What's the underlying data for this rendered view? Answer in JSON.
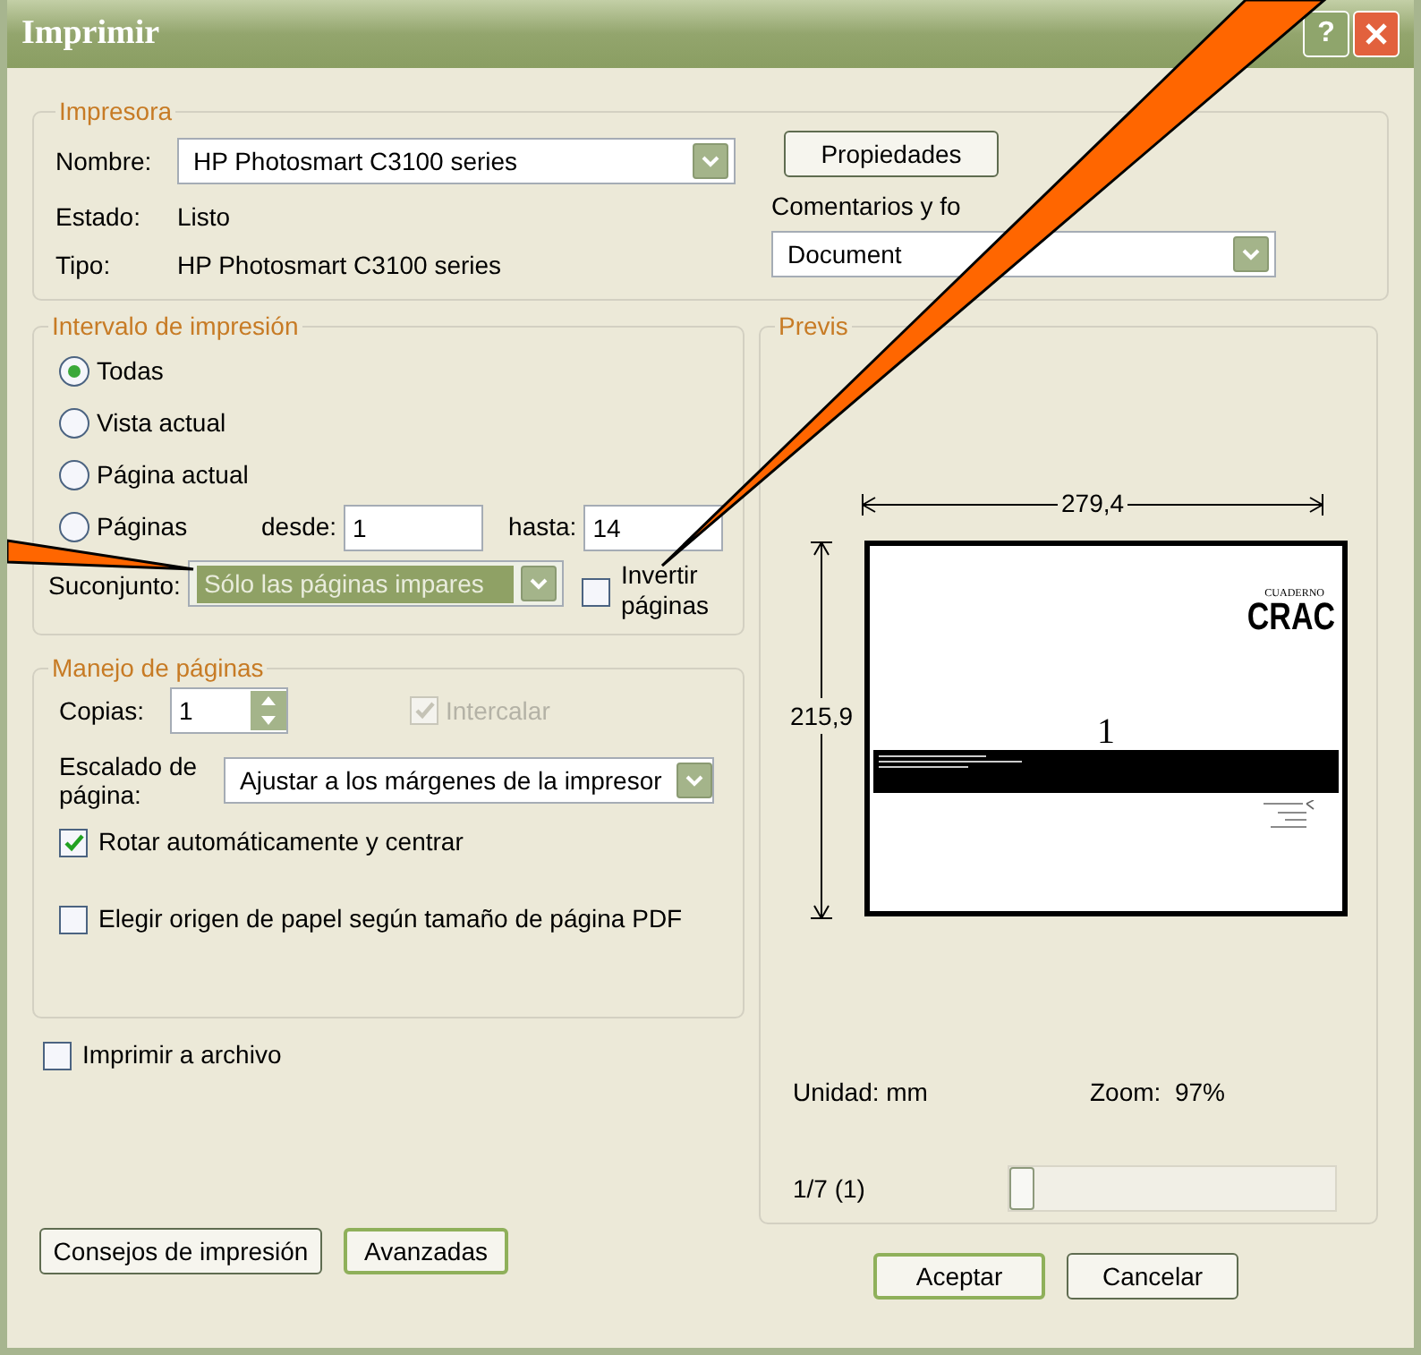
{
  "window": {
    "title": "Imprimir",
    "help_label": "?"
  },
  "printer": {
    "group_title": "Impresora",
    "name_label": "Nombre:",
    "name_value": "HP Photosmart C3100 series",
    "status_label": "Estado:",
    "status_value": "Listo",
    "type_label": "Tipo:",
    "type_value": "HP Photosmart C3100 series",
    "properties_button": "Propiedades",
    "comments_label": "Comentarios y fo",
    "comments_value": "Document"
  },
  "print_range": {
    "group_title": "Intervalo de impresión",
    "options": [
      {
        "label": "Todas",
        "selected": true
      },
      {
        "label": "Vista actual",
        "selected": false
      },
      {
        "label": "Página actual",
        "selected": false
      },
      {
        "label": "Páginas",
        "selected": false
      }
    ],
    "from_label": "desde:",
    "from_value": "1",
    "to_label": "hasta:",
    "to_value": "14",
    "subset_label": "Suconjunto:",
    "subset_value": "Sólo las páginas impares",
    "reverse": {
      "label": "Invertir páginas",
      "checked": false
    }
  },
  "page_handling": {
    "group_title": "Manejo de páginas",
    "copies_label": "Copias:",
    "copies_value": "1",
    "collate": {
      "label": "Intercalar",
      "checked": true,
      "disabled": true
    },
    "scaling_label": "Escalado de página:",
    "scaling_value": "Ajustar a los márgenes de la impresor",
    "options": [
      {
        "label": "Rotar automáticamente y centrar",
        "checked": true
      },
      {
        "label": "Elegir origen de papel según tamaño de página PDF",
        "checked": false
      }
    ]
  },
  "print_to_file": {
    "label": "Imprimir a archivo",
    "checked": false
  },
  "preview": {
    "group_title": "Previs",
    "width_dim": "279,4",
    "height_dim": "215,9",
    "logo_small": "CUADERNO",
    "logo": "CRAC",
    "page_number": "1",
    "unit": "Unidad: mm",
    "zoom": "Zoom:  97%",
    "page_counter": "1/7 (1)",
    "slider": {
      "level": 0
    }
  },
  "left_buttons": [
    {
      "label": "Consejos de impresión",
      "focused": false
    },
    {
      "label": "Avanzadas",
      "focused": true
    }
  ],
  "right_buttons": [
    {
      "label": "Aceptar",
      "focused": true
    },
    {
      "label": "Cancelar",
      "focused": false
    }
  ]
}
